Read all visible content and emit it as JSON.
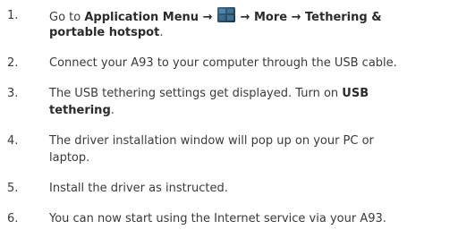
{
  "steps": [
    {
      "num": "1.",
      "go_to": "Go to ",
      "app_menu": "Application Menu",
      "arrow1": " → ",
      "arrow2": " → ",
      "more": "More",
      "arrow3": " → ",
      "tethering_l1": "Tethering &",
      "tethering_l2": "portable hotspot",
      "period": ".",
      "icon": "application-menu-icon"
    },
    {
      "num": "2.",
      "text": "Connect your A93 to your computer through the USB cable."
    },
    {
      "num": "3.",
      "text_l1": "The USB tethering settings get displayed. Turn on ",
      "bold_l1": "USB",
      "bold_l2": "tethering",
      "period": "."
    },
    {
      "num": "4.",
      "text_l1": "The driver installation window will pop up on your PC or",
      "text_l2": "laptop."
    },
    {
      "num": "5.",
      "text": "Install the driver as instructed."
    },
    {
      "num": "6.",
      "text": "You can now start using the Internet service via your A93."
    }
  ]
}
